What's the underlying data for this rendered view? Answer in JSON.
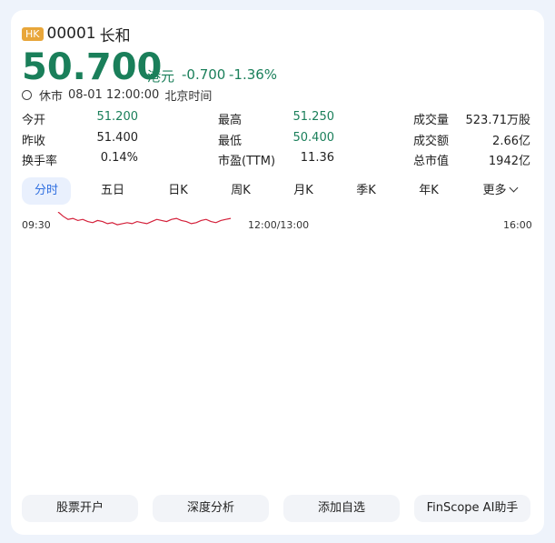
{
  "header": {
    "market_badge": "HK",
    "code": "00001",
    "name": "长和"
  },
  "price": {
    "last": "50.700",
    "unit": "港元",
    "change": "-0.700",
    "change_pct": "-1.36%"
  },
  "status": {
    "state": "休市",
    "datetime": "08-01 12:00:00",
    "timezone": "北京时间"
  },
  "quote": {
    "open_label": "今开",
    "open": "51.200",
    "prev_close_label": "昨收",
    "prev_close": "51.400",
    "turnover_rate_label": "换手率",
    "turnover_rate": "0.14%",
    "high_label": "最高",
    "high": "51.250",
    "low_label": "最低",
    "low": "50.400",
    "pe_label": "市盈(TTM)",
    "pe": "11.36",
    "volume_label": "成交量",
    "volume": "523.71万股",
    "amount_label": "成交额",
    "amount": "2.66亿",
    "mktcap_label": "总市值",
    "mktcap": "1942亿"
  },
  "tabs": [
    {
      "label": "分时"
    },
    {
      "label": "五日"
    },
    {
      "label": "日K"
    },
    {
      "label": "周K"
    },
    {
      "label": "月K"
    },
    {
      "label": "季K"
    },
    {
      "label": "年K"
    },
    {
      "label": "更多"
    }
  ],
  "active_tab": "分时",
  "chart_data": {
    "type": "line",
    "x_ticks": [
      "09:30",
      "12:00/13:00",
      "16:00"
    ],
    "series_color": "#d4203a",
    "values": [
      51.25,
      51.05,
      50.9,
      50.95,
      50.85,
      50.9,
      50.8,
      50.75,
      50.85,
      50.8,
      50.7,
      50.75,
      50.65,
      50.7,
      50.75,
      50.7,
      50.8,
      50.75,
      50.7,
      50.8,
      50.9,
      50.85,
      50.8,
      50.9,
      50.95,
      50.85,
      50.8,
      50.7,
      50.75,
      50.85,
      50.9,
      50.8,
      50.75,
      50.85,
      50.9,
      50.95
    ]
  },
  "actions": {
    "open_account": "股票开户",
    "deep_analysis": "深度分析",
    "add_watchlist": "添加自选",
    "finscope": "FinScope AI助手"
  },
  "colors": {
    "down_green": "#1a7f5a",
    "line_red": "#d4203a",
    "active_tab_blue": "#2f6fe0",
    "badge_orange": "#e8a63a"
  }
}
